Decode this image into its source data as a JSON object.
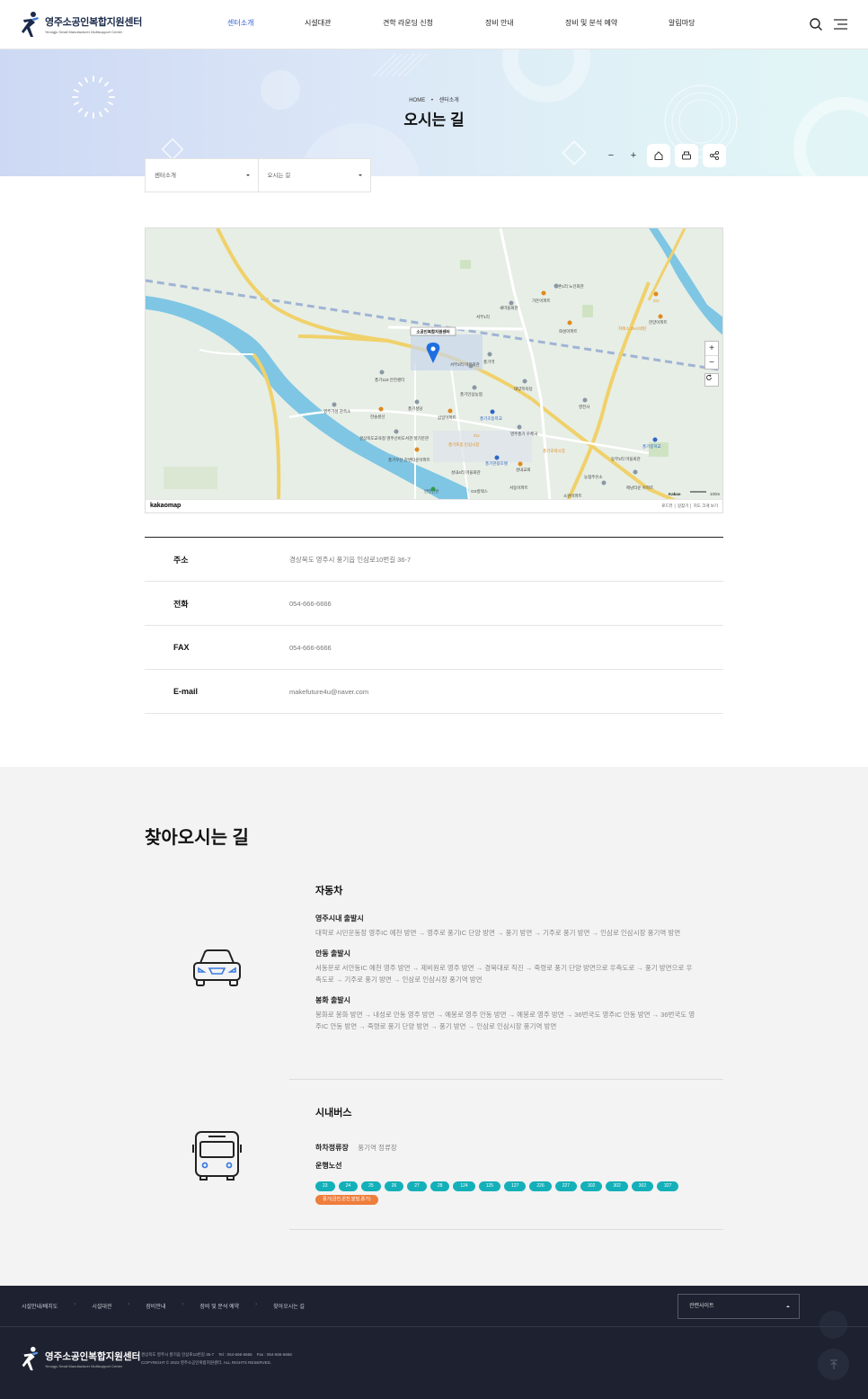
{
  "header": {
    "logo_title": "영주소공인복합지원센터",
    "logo_sub": "Yeongju Small Manufacturer Multisupport Center",
    "nav": [
      {
        "label": "센터소개",
        "active": true
      },
      {
        "label": "시설대관",
        "active": false
      },
      {
        "label": "견학 라운딩 신청",
        "active": false
      },
      {
        "label": "장비 안내",
        "active": false
      },
      {
        "label": "장비 및 분석 예약",
        "active": false
      },
      {
        "label": "알림마당",
        "active": false
      }
    ],
    "icons": [
      "search-icon",
      "menu-icon"
    ]
  },
  "visual": {
    "breadcrumb_home": "HOME",
    "breadcrumb_current": "센터소개",
    "title": "오시는 길",
    "tools": {
      "minus": "−",
      "plus": "+"
    },
    "tool_icons": [
      "home-icon",
      "print-icon",
      "share-icon"
    ],
    "location_select": [
      "센터소개",
      "오시는 길"
    ]
  },
  "map": {
    "brand": "kakaomap",
    "links": "로드뷰 │ 길찾기 │ 지도 크게 보기",
    "center_label": "소공인복합지원센터",
    "labels": [
      "서부1리",
      "새마을회관",
      "근촌1리 노인회관",
      "가든아파트",
      "CU",
      "한양아파트",
      "지에스 25시네펀",
      "화성아파트",
      "풍기역",
      "서부2리 마을회관",
      "풍기119 안전센터",
      "풍기인삼농협",
      "태양목욕탕",
      "영전사",
      "풍기성당",
      "영주가성 관측소",
      "한솔센선",
      "삼일아파트",
      "풍기초등학교",
      "CU",
      "영주풍기 우체국",
      "풍기호박시장",
      "경상북도교육청 영주선비도서관 풍기분관",
      "풍기우신 강변타운아파트",
      "풍기토종 인삼시장",
      "풍기관광호텔",
      "성내4리 마을회관",
      "성내교회",
      "서동아파트",
      "풍기중학교",
      "동부2리 마을회관",
      "농협주유소",
      "에남타운 아파트",
      "소원아파트",
      "안전만빈",
      "GS칼텍스",
      "100m",
      "Kakao"
    ]
  },
  "info": [
    {
      "key": "주소",
      "value": "경상북도 영주시 풍기읍 인삼로10번길 36-7"
    },
    {
      "key": "전화",
      "value": "054-666-6666"
    },
    {
      "key": "FAX",
      "value": "054-666-6666"
    },
    {
      "key": "E-mail",
      "value": "makefuture4u@naver.com"
    }
  ],
  "directions": {
    "title": "찾아오시는 길",
    "car": {
      "heading": "자동차",
      "icon": "car-icon",
      "routes": [
        {
          "from": "영주시내 출발시",
          "text": "대학로 시민운동장 영주IC 예천 방면 → 영주로 풍기IC 단양 방면 → 풍기 방면 → 기주로 풍기 방면 → 인삼로 인삼시장 풍기역 방면"
        },
        {
          "from": "안동 출발시",
          "text": "서동문로 서안동IC 예천 영주 방면 → 제비원로 영주 방면 → 경북대로 직진 → 죽령로 풍기 단양 방면으로 우측도로 → 풍기 방면으로 우측도로 → 기주로 풍기 방면 → 인삼로 인삼시장 풍기역 방면"
        },
        {
          "from": "봉화 출발시",
          "text": "봉화로 봉화 방면 → 내성로 안동 영주 방면 → 예봉로 영주 안동 방면 → 예봉로 영주 방면 → 36번국도 영주IC 안동 방면 → 36번국도 영주IC 안동 방면 → 죽령로 풍기 단양 방면 → 풍기 방면 → 인삼로 인삼시장 풍기역 방면"
        }
      ]
    },
    "bus": {
      "heading": "시내버스",
      "icon": "bus-icon",
      "stop_label": "하차정류장",
      "stop_value": "풍기역 정류장",
      "lines_label": "운행노선",
      "lines": [
        "23",
        "24",
        "25",
        "26",
        "27",
        "28",
        "124",
        "125",
        "127",
        "226",
        "227",
        "302",
        "302",
        "302",
        "327"
      ],
      "special_line": "풍기(금전,온천,발빌,풍기)"
    }
  },
  "footer": {
    "links": [
      "시설안내/배치도",
      "시설대관",
      "장비안내",
      "장비 및 분석 예약",
      "찾아오시는 길"
    ],
    "related_site": "관련사이트",
    "logo_title": "영주소공인복합지원센터",
    "logo_sub": "Yeongju Small Manufacturer Multisupport Center",
    "address_line": "경상북도 영주시 풍기읍 인삼로10번길 36-7    Tel : 054-666-6666    Fax : 054-666-6666",
    "copyright": "COPYRIGHT © 2023 영주소공인복합지원센터. ALL RIGHTS RESERVED.",
    "top_icon": "arrow-up-icon"
  },
  "colors": {
    "accent": "#2a5cd6",
    "bus_chip": "#14b0b9",
    "special_chip": "#ef7d3b",
    "footer_bg": "#1e2230"
  }
}
